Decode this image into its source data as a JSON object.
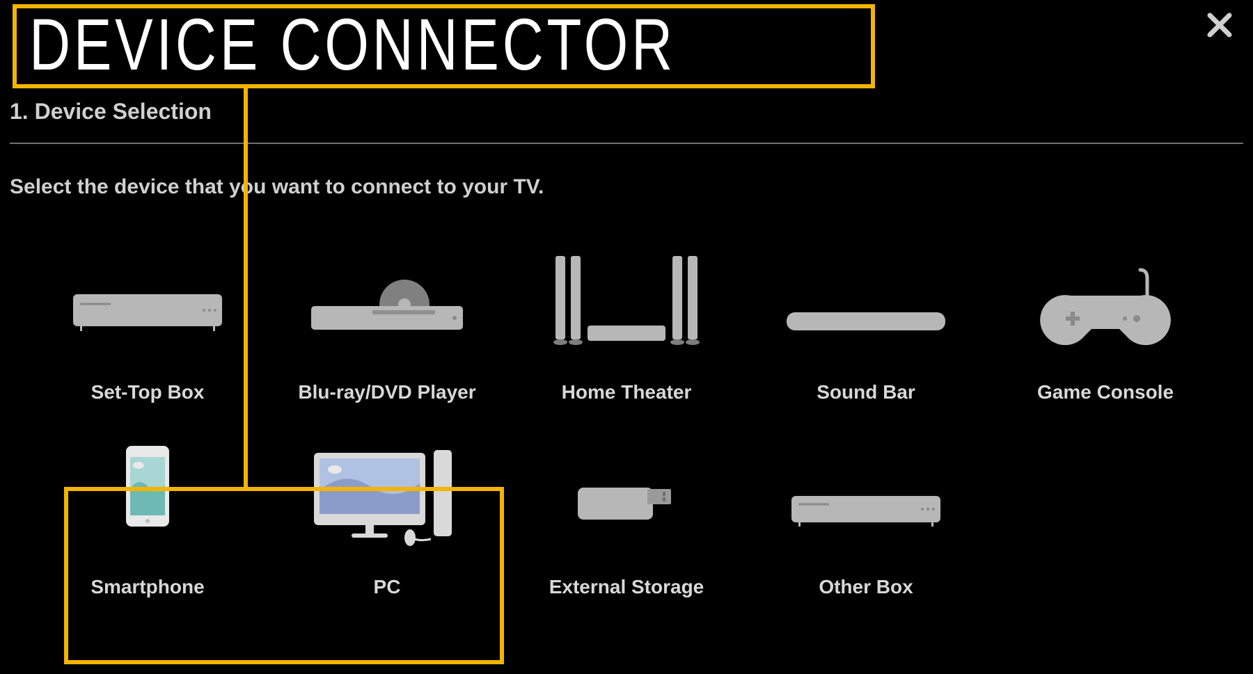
{
  "title": "DEVICE CONNECTOR",
  "step_label": "1. Device Selection",
  "instruction": "Select the device that you want to connect to your TV.",
  "close_label": "Close",
  "devices": {
    "stb": {
      "label": "Set-Top Box"
    },
    "bluray": {
      "label": "Blu-ray/DVD Player"
    },
    "theater": {
      "label": "Home Theater"
    },
    "soundbar": {
      "label": "Sound Bar"
    },
    "console": {
      "label": "Game Console"
    },
    "phone": {
      "label": "Smartphone"
    },
    "pc": {
      "label": "PC"
    },
    "storage": {
      "label": "External Storage"
    },
    "otherbox": {
      "label": "Other Box"
    }
  },
  "highlight": {
    "color": "#f3b400",
    "targets": [
      "title",
      "phone",
      "pc"
    ]
  }
}
